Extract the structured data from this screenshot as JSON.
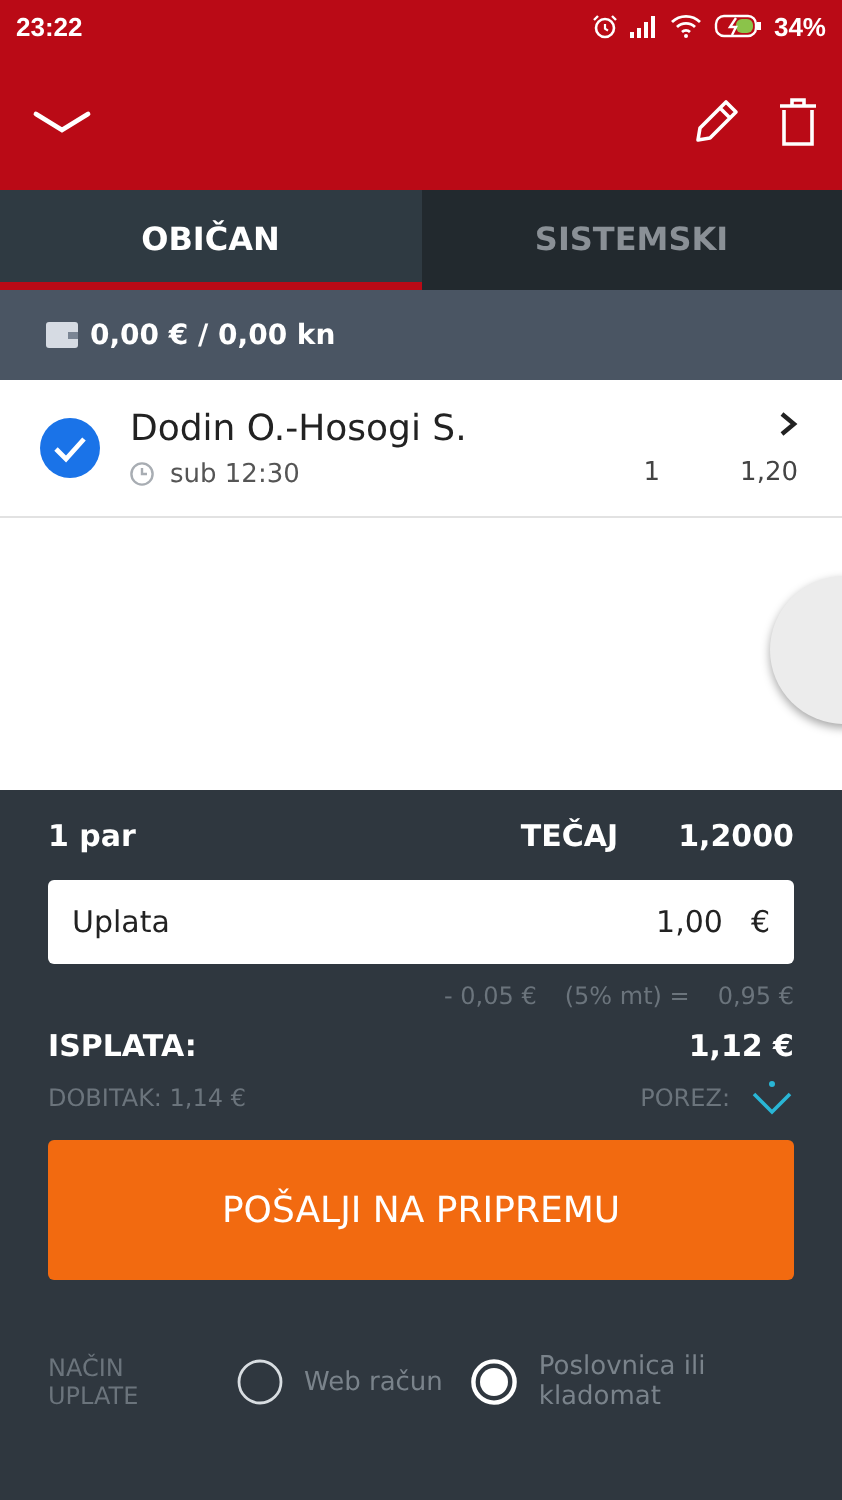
{
  "status_bar": {
    "time": "23:22",
    "battery": "34%"
  },
  "tabs": [
    {
      "label": "OBIČAN",
      "selected": true
    },
    {
      "label": "SISTEMSKI",
      "selected": false
    }
  ],
  "balance": "0,00 € / 0,00 kn",
  "bets": [
    {
      "name": "Dodin O.-Hosogi S.",
      "checked": true,
      "time": "sub 12:30",
      "column_2": "1",
      "odds": "1,20"
    }
  ],
  "summary": {
    "pairs": "1 par",
    "rate_label": "TEČAJ",
    "rate": "1,2000",
    "stake": {
      "label": "Uplata",
      "value": "1,00",
      "currency": "€"
    },
    "fee": "- 0,05 €",
    "fee_note": "(5% mt) =",
    "net": "0,95 €",
    "payout_label": "ISPLATA:",
    "payout": "1,12 €",
    "win": "DOBITAK: 1,14 €",
    "tax_label": "POREZ:"
  },
  "submit": "POŠALJI NA PRIPREMU",
  "payment": {
    "label": "NAČIN UPLATE",
    "options": [
      {
        "label": "Web račun",
        "selected": false
      },
      {
        "label": "Poslovnica ili kladomat",
        "selected": true
      }
    ]
  }
}
